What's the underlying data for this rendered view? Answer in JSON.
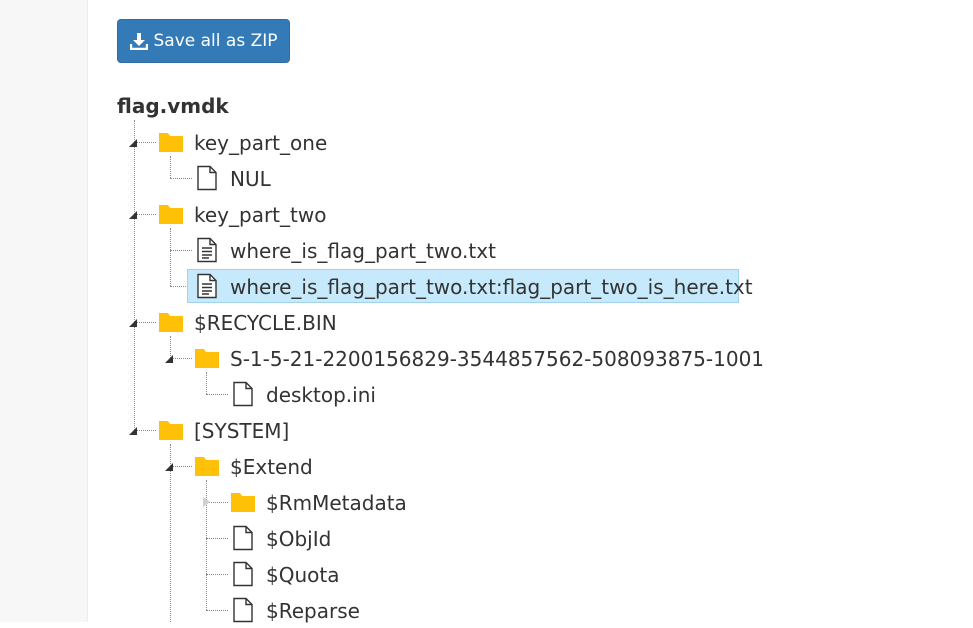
{
  "toolbar": {
    "save_zip_label": "Save all as ZIP",
    "icon": "download-icon"
  },
  "tree": {
    "root": "flag.vmdk",
    "items": [
      {
        "id": "key-part-one",
        "label": "key_part_one",
        "type": "folder",
        "expanded": true
      },
      {
        "id": "nul",
        "label": "NUL",
        "type": "file"
      },
      {
        "id": "key-part-two",
        "label": "key_part_two",
        "type": "folder",
        "expanded": true
      },
      {
        "id": "where-is-flag",
        "label": "where_is_flag_part_two.txt",
        "type": "text-file"
      },
      {
        "id": "flag-ads",
        "label": "where_is_flag_part_two.txt:flag_part_two_is_here.txt",
        "type": "text-file",
        "selected": true
      },
      {
        "id": "recycle-bin",
        "label": "$RECYCLE.BIN",
        "type": "folder",
        "expanded": true
      },
      {
        "id": "sid-folder",
        "label": "S-1-5-21-2200156829-3544857562-508093875-1001",
        "type": "folder",
        "expanded": true
      },
      {
        "id": "desktop-ini",
        "label": "desktop.ini",
        "type": "file"
      },
      {
        "id": "system",
        "label": "[SYSTEM]",
        "type": "folder",
        "expanded": true
      },
      {
        "id": "extend",
        "label": "$Extend",
        "type": "folder",
        "expanded": true
      },
      {
        "id": "rmmetadata",
        "label": "$RmMetadata",
        "type": "folder",
        "expanded": false
      },
      {
        "id": "objid",
        "label": "$ObjId",
        "type": "file"
      },
      {
        "id": "quota",
        "label": "$Quota",
        "type": "file"
      },
      {
        "id": "reparse",
        "label": "$Reparse",
        "type": "file"
      }
    ]
  },
  "colors": {
    "button": "#337ab7",
    "folder": "#ffc107",
    "selection": "#c6eafb",
    "text": "#333333"
  }
}
